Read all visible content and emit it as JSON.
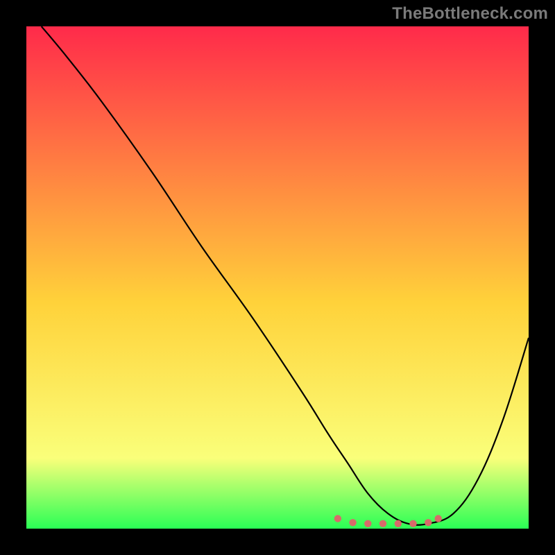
{
  "watermark": "TheBottleneck.com",
  "colors": {
    "brand_pink": "#ff2a4a",
    "gradient_top": "#ff2a4a",
    "gradient_mid": "#ffd23a",
    "gradient_low": "#faff7a",
    "gradient_bottom": "#2aff55",
    "curve": "#000000",
    "marker": "#d86a6a",
    "frame": "#000000"
  },
  "chart_data": {
    "type": "line",
    "title": "",
    "xlabel": "",
    "ylabel": "",
    "xlim": [
      0,
      100
    ],
    "ylim": [
      0,
      100
    ],
    "x": [
      3,
      8,
      15,
      25,
      35,
      45,
      55,
      60,
      64,
      68,
      72,
      76,
      80,
      85,
      90,
      95,
      100
    ],
    "values": [
      100,
      94,
      85,
      71,
      56,
      42,
      27,
      19,
      13,
      7,
      3,
      1,
      1,
      3,
      10,
      22,
      38
    ],
    "marker_points": {
      "x": [
        62,
        65,
        68,
        71,
        74,
        77,
        80,
        82
      ],
      "y": [
        2,
        1.2,
        1,
        1,
        1,
        1,
        1.2,
        2
      ]
    },
    "annotations": []
  }
}
